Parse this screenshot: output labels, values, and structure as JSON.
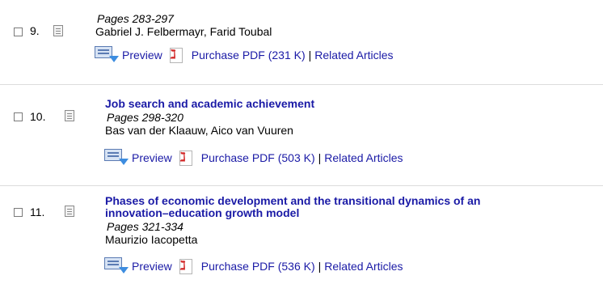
{
  "items": [
    {
      "number": "9.",
      "title": "",
      "pages": "Pages 283-297",
      "authors": "Gabriel J. Felbermayr, Farid Toubal",
      "preview_label": "Preview",
      "pdf_label": "Purchase PDF (231 K)",
      "separator": "|",
      "related_label": "Related Articles"
    },
    {
      "number": "10.",
      "title": "Job search and academic achievement",
      "pages": "Pages 298-320",
      "authors": "Bas van der Klaauw, Aico van Vuuren",
      "preview_label": "Preview",
      "pdf_label": "Purchase PDF (503 K)",
      "separator": "|",
      "related_label": "Related Articles"
    },
    {
      "number": "11.",
      "title_line1": "Phases of economic development and the transitional dynamics of an",
      "title_line2": "innovation–education growth model",
      "pages": "Pages 321-334",
      "authors": "Maurizio Iacopetta",
      "preview_label": "Preview",
      "pdf_label": "Purchase PDF (536 K)",
      "separator": "|",
      "related_label": "Related Articles"
    }
  ]
}
